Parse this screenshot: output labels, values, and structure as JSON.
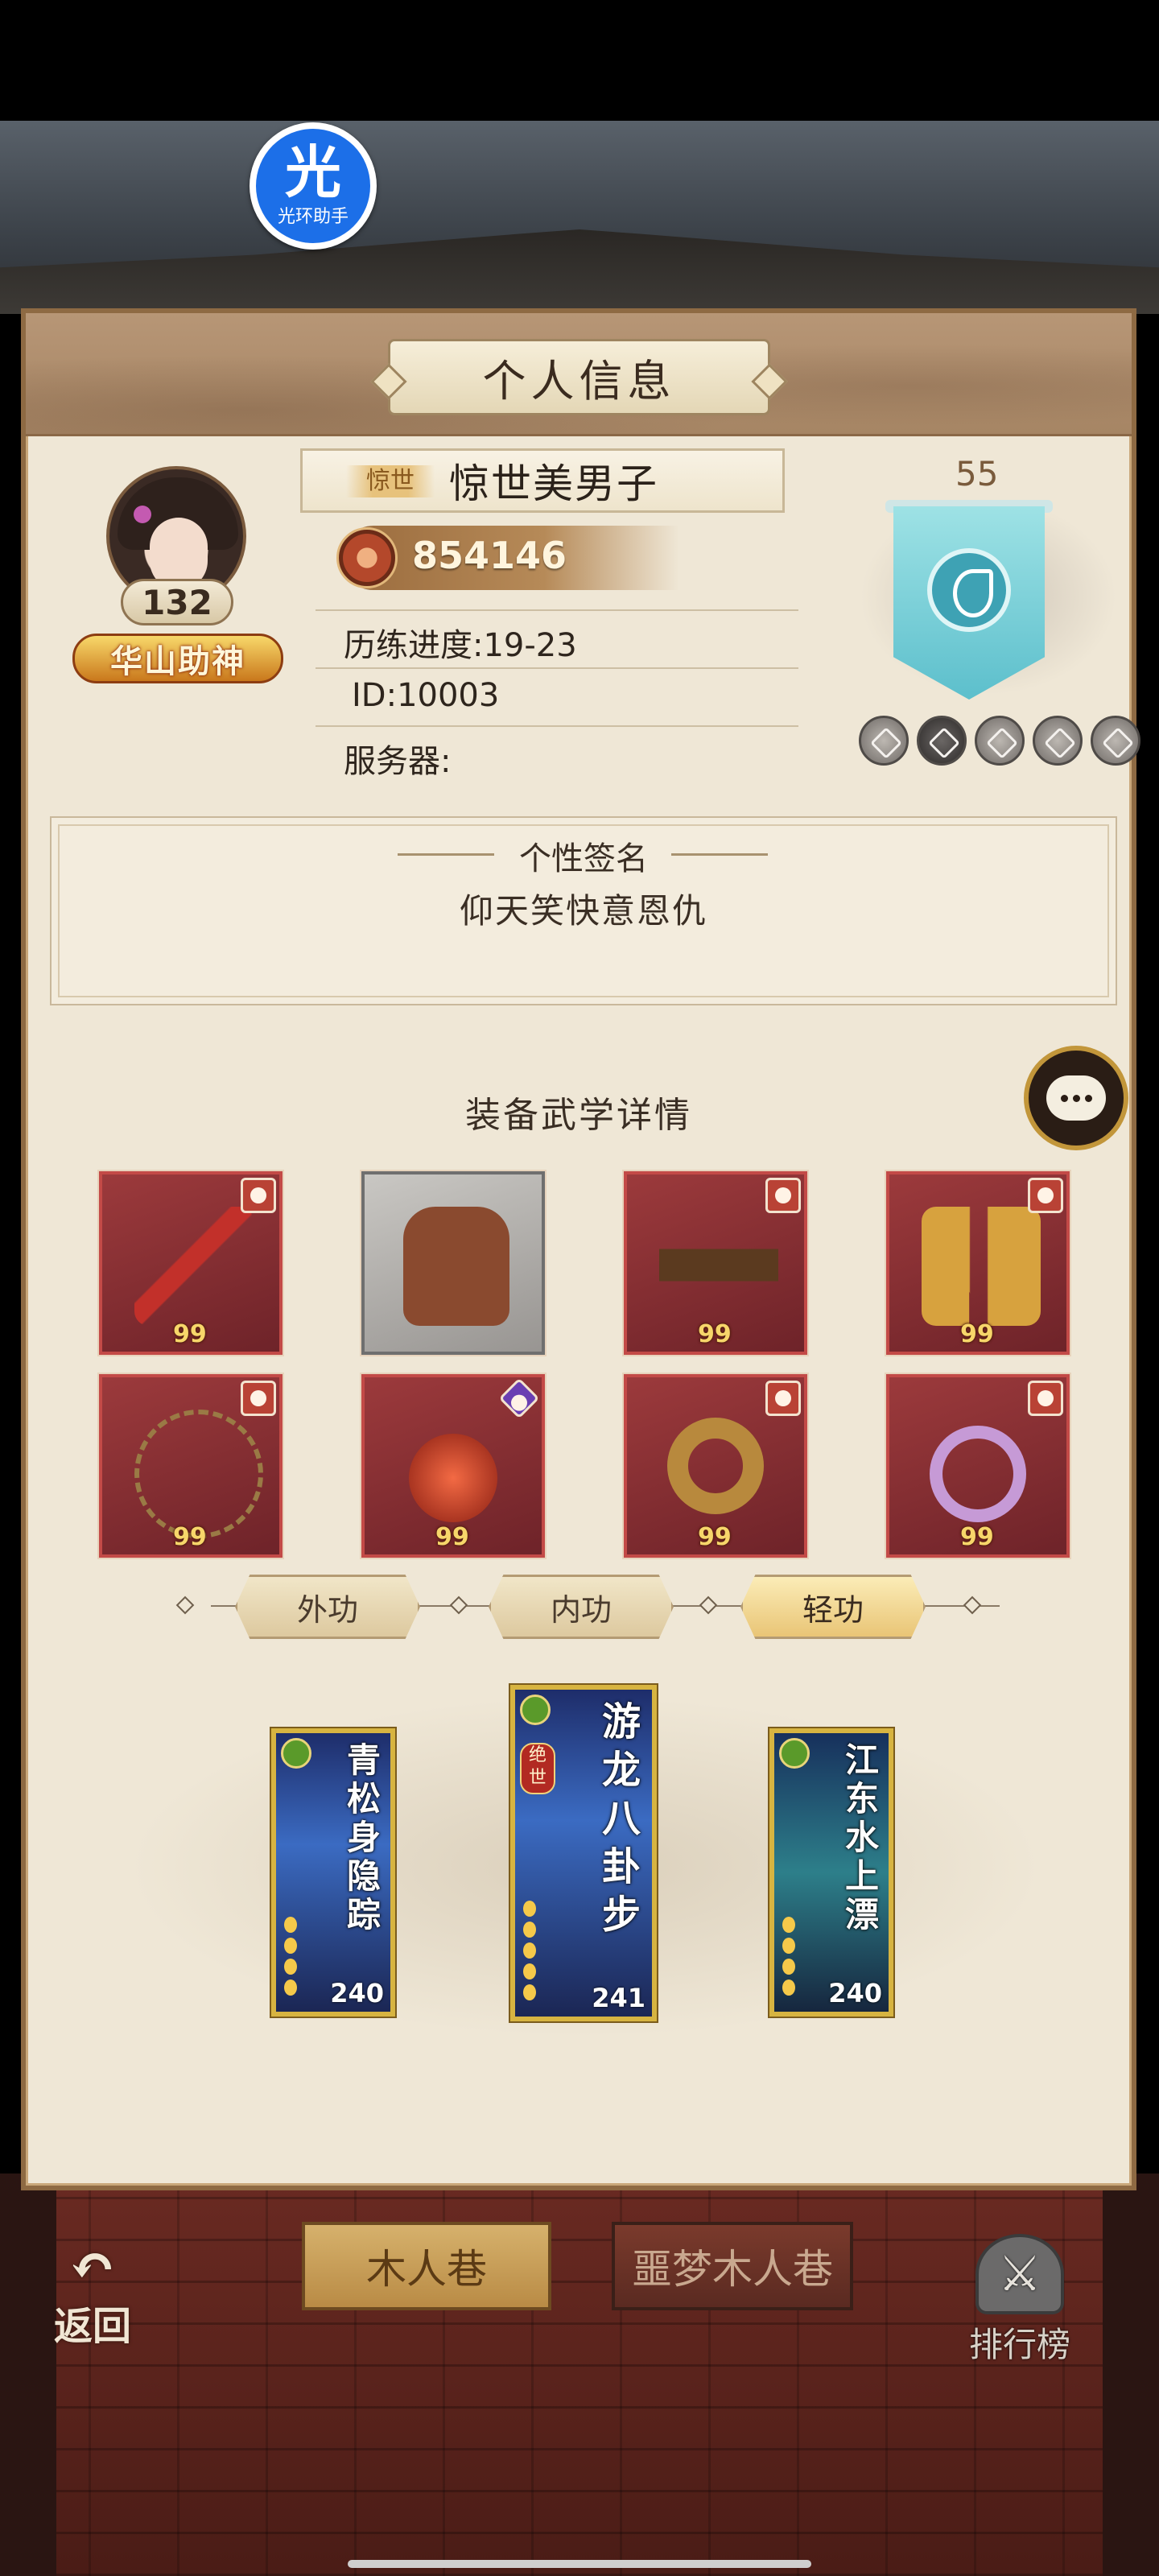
{
  "overlay_badge": {
    "glyph": "光",
    "text": "光环助手"
  },
  "panel": {
    "title": "个人信息"
  },
  "profile": {
    "level": "132",
    "rank_title": "华山助神",
    "name_tag": "惊世",
    "name": "惊世美男子",
    "power": "854146",
    "progress_label": "历练进度:19-23",
    "id_label": "ID:10003",
    "server_label": "服务器:"
  },
  "rank": {
    "level": "55",
    "icons": [
      "rank-icon-1",
      "rank-icon-2",
      "rank-icon-3",
      "rank-icon-4",
      "rank-icon-5"
    ]
  },
  "signature": {
    "title": "个性签名",
    "text": "仰天笑快意恩仇"
  },
  "equipment": {
    "title": "装备武学详情",
    "items": [
      {
        "name": "weapon",
        "level": "99",
        "quality": "red"
      },
      {
        "name": "armor",
        "level": "",
        "quality": "gray"
      },
      {
        "name": "belt",
        "level": "99",
        "quality": "red"
      },
      {
        "name": "boots",
        "level": "99",
        "quality": "red"
      },
      {
        "name": "necklace",
        "level": "99",
        "quality": "red"
      },
      {
        "name": "amulet",
        "level": "99",
        "quality": "red"
      },
      {
        "name": "bracelet",
        "level": "99",
        "quality": "red"
      },
      {
        "name": "ring",
        "level": "99",
        "quality": "red"
      }
    ]
  },
  "tabs": [
    {
      "label": "外功",
      "active": false
    },
    {
      "label": "内功",
      "active": false
    },
    {
      "label": "轻功",
      "active": true
    }
  ],
  "skills": [
    {
      "name": "青松身隐踪",
      "value": "240"
    },
    {
      "name": "游龙八卦步",
      "value": "241",
      "tag": "绝世"
    },
    {
      "name": "江东水上漂",
      "value": "240"
    }
  ],
  "bottom": {
    "back_label": "返回",
    "btn_wood": "木人巷",
    "btn_nightmare": "噩梦木人巷",
    "leaderboard": "排行榜"
  }
}
